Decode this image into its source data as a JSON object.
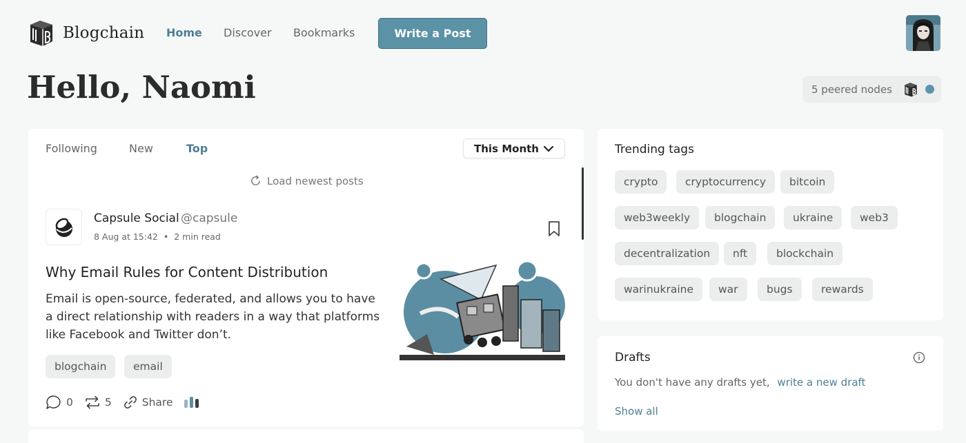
{
  "app": {
    "name": "Blogchain"
  },
  "nav": {
    "home": "Home",
    "discover": "Discover",
    "bookmarks": "Bookmarks",
    "write": "Write a Post"
  },
  "greeting": "Hello, Naomi",
  "peers": {
    "label": "5 peered nodes",
    "status_color": "#5e93ad"
  },
  "feed": {
    "tabs": [
      "Following",
      "New",
      "Top"
    ],
    "active_tab": "Top",
    "period": "This Month",
    "load_newest": "Load newest posts"
  },
  "post": {
    "author": "Capsule Social",
    "handle": "@capsule",
    "date": "8 Aug at 15:42",
    "read_time": "2 min read",
    "title": "Why Email Rules for Content Distribution",
    "excerpt": "Email is open-source, federated, and allows you to have a direct relationship with readers in a way that platforms like Facebook and Twitter don’t.",
    "tags": [
      "blogchain",
      "email"
    ],
    "comments": "0",
    "reposts": "5",
    "share": "Share"
  },
  "trending": {
    "title": "Trending tags",
    "tags": [
      "crypto",
      "cryptocurrency",
      "bitcoin",
      "web3weekly",
      "blogchain",
      "ukraine",
      "web3",
      "decentralization",
      "nft",
      "blockchain",
      "warinukraine",
      "war",
      "bugs",
      "rewards"
    ]
  },
  "drafts": {
    "title": "Drafts",
    "empty_text": "You don't have any drafts yet,",
    "new_link": "write a new draft",
    "show_all": "Show all"
  },
  "colors": {
    "accent": "#5b92a6",
    "link": "#4e7f94",
    "background": "#f6f7f7"
  }
}
